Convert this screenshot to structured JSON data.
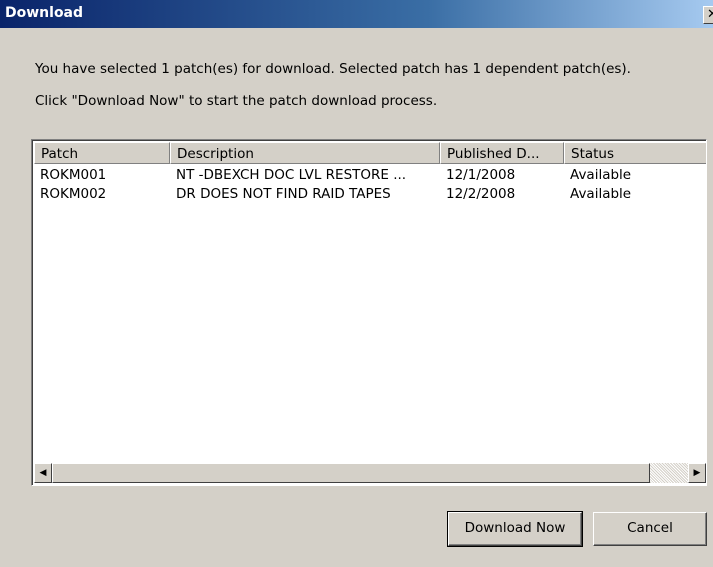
{
  "window": {
    "title": "Download",
    "close_glyph": "✕"
  },
  "message": {
    "line1": "You have selected 1 patch(es) for download. Selected patch has 1 dependent patch(es).",
    "line2": "Click \"Download Now\" to start the patch download process."
  },
  "table": {
    "columns": [
      "Patch",
      "Description",
      "Published D...",
      "Status"
    ],
    "rows": [
      [
        "ROKM001",
        "NT -DBEXCH DOC LVL RESTORE ...",
        "12/1/2008",
        "Available"
      ],
      [
        "ROKM002",
        "DR DOES NOT FIND RAID TAPES",
        "12/2/2008",
        "Available"
      ]
    ]
  },
  "scrollbar": {
    "left_glyph": "◀",
    "right_glyph": "▶",
    "thumb_fraction": 0.94
  },
  "buttons": {
    "download_label": "Download Now",
    "cancel_label": "Cancel"
  },
  "icons": {
    "close": "close-icon",
    "scroll_left": "arrow-left-icon",
    "scroll_right": "arrow-right-icon"
  },
  "colors": {
    "titlebar_start": "#0a246a",
    "titlebar_end": "#a6caf0",
    "dialog_bg": "#d4d0c8"
  }
}
